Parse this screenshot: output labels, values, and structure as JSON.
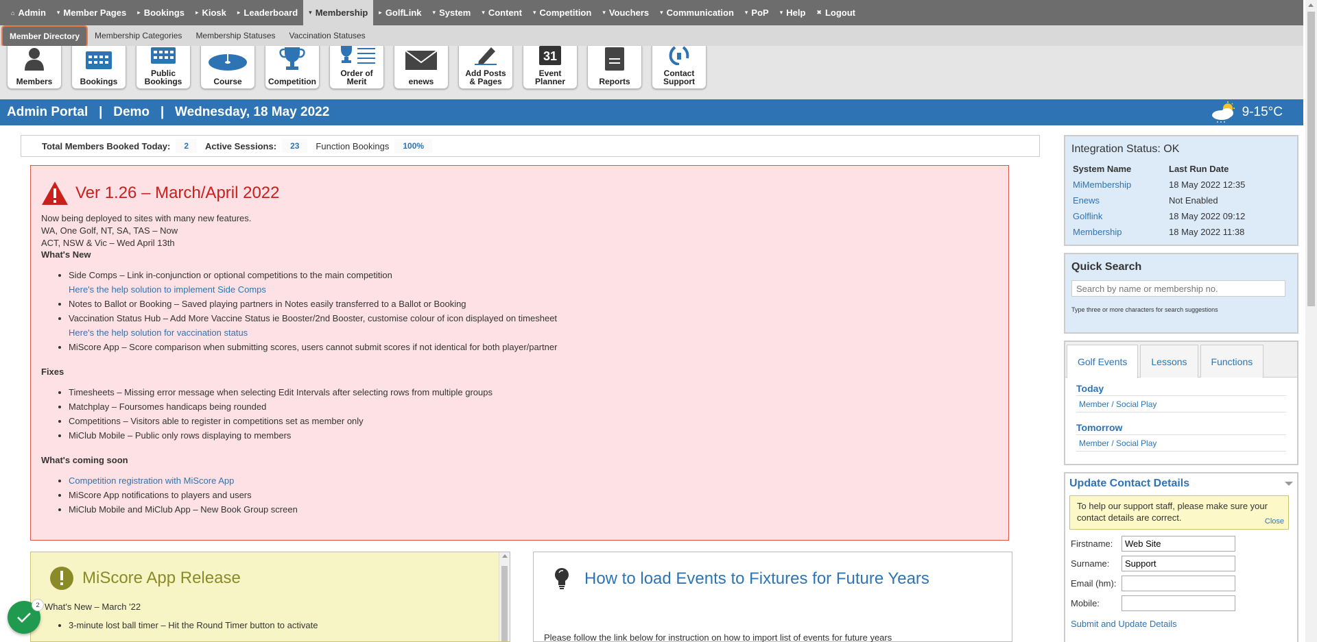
{
  "topnav": {
    "items": [
      {
        "label": "Admin",
        "glyph": "⌂"
      },
      {
        "label": "Member Pages",
        "glyph": "▾"
      },
      {
        "label": "Bookings",
        "glyph": "▸"
      },
      {
        "label": "Kiosk",
        "glyph": "▸"
      },
      {
        "label": "Leaderboard",
        "glyph": "▸"
      },
      {
        "label": "Membership",
        "glyph": "▾"
      },
      {
        "label": "GolfLink",
        "glyph": "▸"
      },
      {
        "label": "System",
        "glyph": "▾"
      },
      {
        "label": "Content",
        "glyph": "▾"
      },
      {
        "label": "Competition",
        "glyph": "▾"
      },
      {
        "label": "Vouchers",
        "glyph": "▾"
      },
      {
        "label": "Communication",
        "glyph": "▾"
      },
      {
        "label": "PoP",
        "glyph": "▾"
      },
      {
        "label": "Help",
        "glyph": "▾"
      },
      {
        "label": "Logout",
        "glyph": "✖"
      }
    ]
  },
  "subnav": {
    "items": [
      {
        "label": "Member Directory"
      },
      {
        "label": "Membership Categories"
      },
      {
        "label": "Membership Statuses"
      },
      {
        "label": "Vaccination Statuses"
      }
    ]
  },
  "quickbar": {
    "tiles": [
      {
        "label1": "Members",
        "label2": "",
        "icon": "members-icon"
      },
      {
        "label1": "Bookings",
        "label2": "",
        "icon": "bookings-icon"
      },
      {
        "label1": "Public",
        "label2": "Bookings",
        "icon": "public-bookings-icon"
      },
      {
        "label1": "Course",
        "label2": "",
        "icon": "course-icon"
      },
      {
        "label1": "Competition",
        "label2": "",
        "icon": "trophy-icon"
      },
      {
        "label1": "Order of",
        "label2": "Merit",
        "icon": "order-of-merit-icon"
      },
      {
        "label1": "enews",
        "label2": "",
        "icon": "envelope-icon"
      },
      {
        "label1": "Add Posts",
        "label2": "& Pages",
        "icon": "pen-icon"
      },
      {
        "label1": "Event",
        "label2": "Planner",
        "icon": "calendar-icon",
        "day": "31"
      },
      {
        "label1": "Reports",
        "label2": "",
        "icon": "reports-icon"
      },
      {
        "label1": "Contact",
        "label2": "Support",
        "icon": "phone-icon"
      }
    ]
  },
  "portal": {
    "title": "Admin Portal   |   Demo   |   Wednesday, 18 May 2022",
    "weather": "9-15°C"
  },
  "stats": {
    "members_booked_label": "Total Members Booked Today:",
    "members_booked_value": "2",
    "sessions_label": "Active Sessions:",
    "sessions_value": "23",
    "function_label": "Function Bookings",
    "function_value": "100%"
  },
  "announcement": {
    "title": "Ver 1.26 – March/April 2022",
    "intro": [
      "Now being deployed to sites with many new features.",
      "WA, One Golf, NT, SA, TAS – Now",
      "ACT, NSW & Vic – Wed April 13th"
    ],
    "whats_new_heading": "What's New",
    "whats_new": [
      {
        "text": "Side Comps – Link in-conjunction or optional competitions to the main competition",
        "link": "Here's the help solution to implement Side Comps"
      },
      {
        "text": "Notes to Ballot or Booking – Saved playing partners in Notes easily transferred to a Ballot or Booking",
        "link": ""
      },
      {
        "text": "Vaccination Status Hub – Add More Vaccine Status ie Booster/2nd Booster, customise colour of icon displayed on timesheet",
        "link": "Here's the help solution for vaccination status"
      },
      {
        "text": "MiScore App – Score comparison when submitting scores, users cannot submit scores if not identical for both player/partner",
        "link": ""
      }
    ],
    "fixes_heading": "Fixes",
    "fixes": [
      "Timesheets – Missing error message when selecting Edit Intervals after selecting rows from multiple groups",
      "Matchplay – Foursomes handicaps being rounded",
      "Competitions – Visitors able to register in competitions set as member only",
      "MiClub Mobile – Public only rows displaying to members"
    ],
    "coming_heading": "What's coming soon",
    "coming_link": "Competition registration with MiScore App",
    "coming": [
      "MiScore App notifications to players and users",
      "MiClub Mobile and MiClub App – New Book Group screen"
    ]
  },
  "miscore": {
    "title": "MiScore App Release",
    "subtitle": "What's New – March '22",
    "item1": "3-minute lost ball timer – Hit the Round Timer button to activate"
  },
  "howto": {
    "title": "How to load Events to Fixtures for Future Years",
    "text": "Please follow the link below for instruction on how to import list of events for future years"
  },
  "integration": {
    "title": "Integration Status: OK",
    "col1": "System Name",
    "col2": "Last Run Date",
    "rows": [
      {
        "system": "MiMembership",
        "date": "18 May 2022 12:35"
      },
      {
        "system": "Enews",
        "date": "Not Enabled"
      },
      {
        "system": "Golflink",
        "date": "18 May 2022 09:12"
      },
      {
        "system": "Membership",
        "date": "18 May 2022 11:38"
      }
    ]
  },
  "quicksearch": {
    "title": "Quick Search",
    "placeholder": "Search by name or membership no.",
    "hint": "Type three or more characters for search suggestions"
  },
  "events": {
    "tabs": [
      "Golf Events",
      "Lessons",
      "Functions"
    ],
    "today": "Today",
    "today_item": "Member / Social Play",
    "tomorrow": "Tomorrow",
    "tomorrow_item": "Member / Social Play"
  },
  "contact": {
    "title": "Update Contact Details",
    "notice": "To help our support staff, please make sure your contact details are correct.",
    "close": "Close",
    "firstname_label": "Firstname:",
    "firstname_value": "Web Site",
    "surname_label": "Surname:",
    "surname_value": "Support",
    "email_label": "Email (hm):",
    "email_value": "",
    "mobile_label": "Mobile:",
    "mobile_value": "",
    "submit": "Submit and Update Details"
  },
  "fab": {
    "badge": "2"
  },
  "colors": {
    "nav_bg": "#6d6d6d",
    "portal_blue": "#2e74b5",
    "alert_red": "#c9201c",
    "success_green": "#1f9a4e"
  }
}
